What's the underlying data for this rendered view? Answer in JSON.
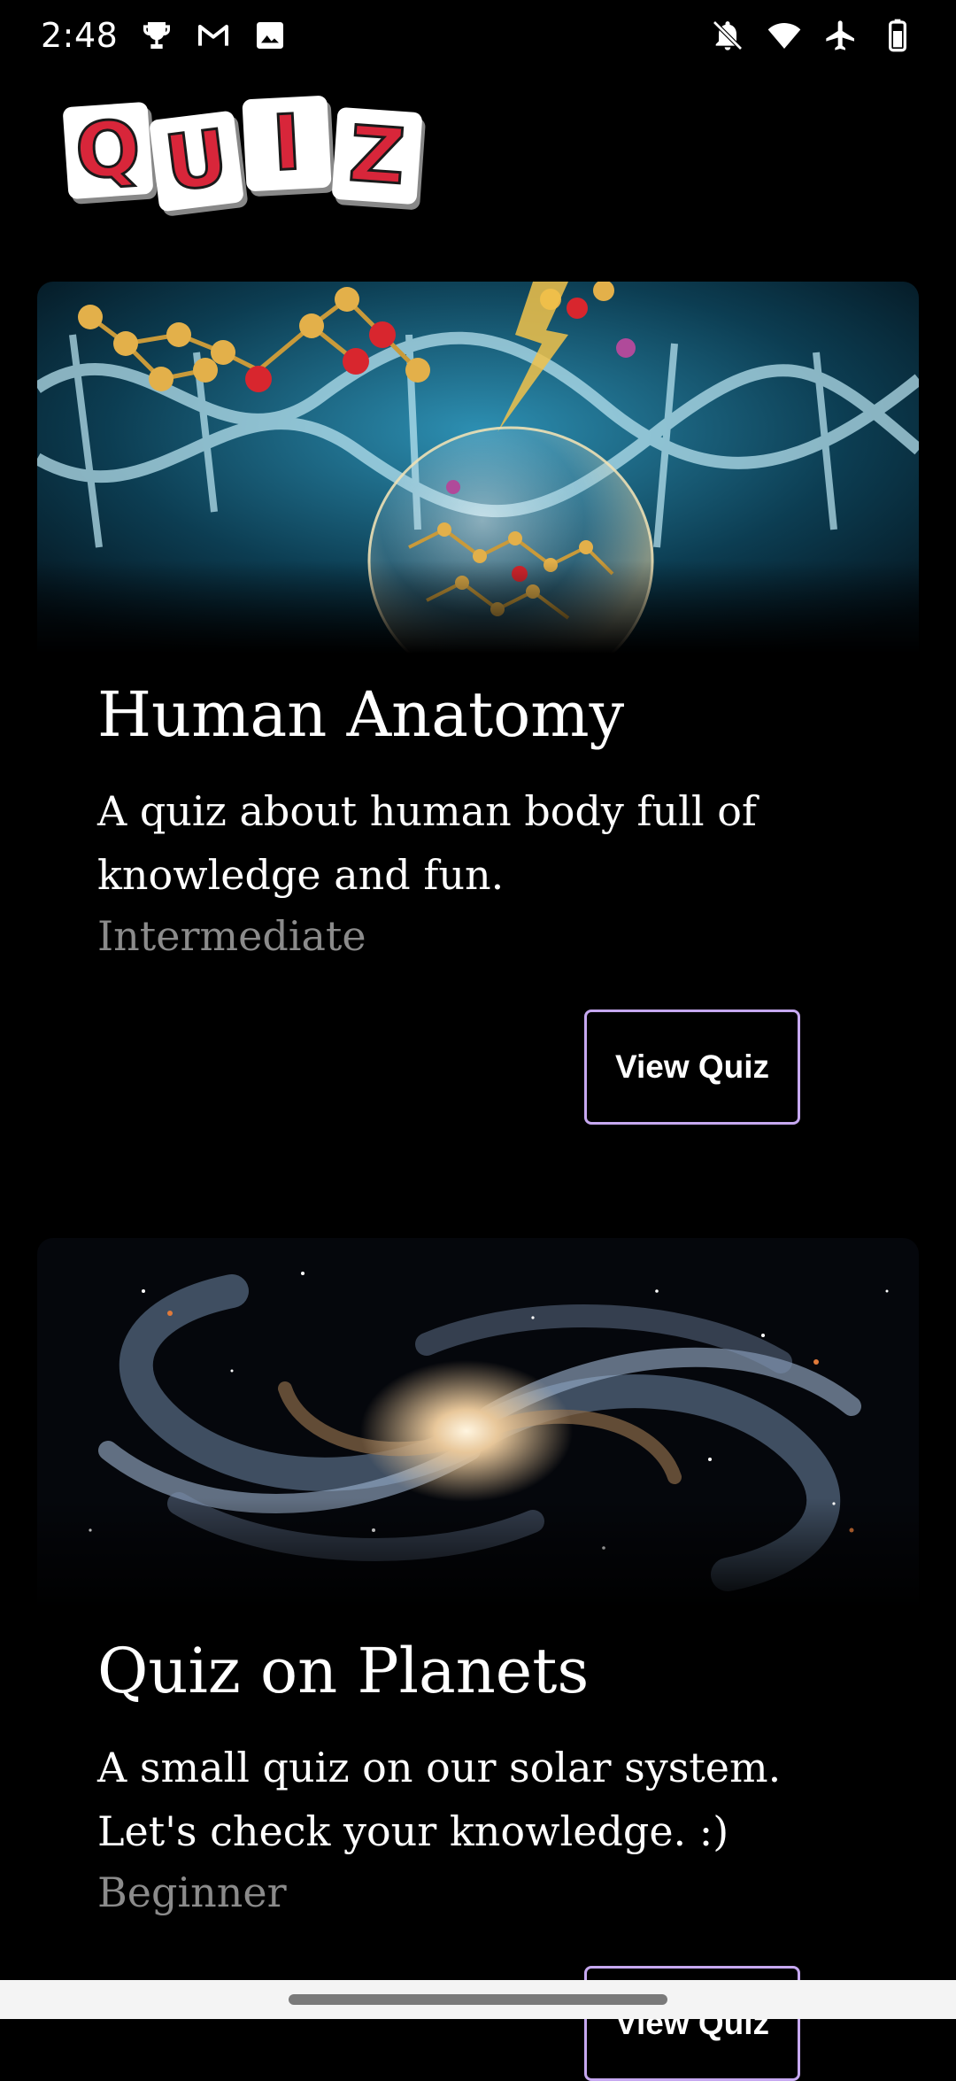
{
  "status_bar": {
    "time": "2:48",
    "left_icons": [
      "trophy-icon",
      "gmail-icon",
      "image-icon"
    ],
    "right_icons": [
      "bell-off-icon",
      "wifi-icon",
      "airplane-icon",
      "battery-icon"
    ]
  },
  "logo": {
    "letters": [
      "Q",
      "U",
      "I",
      "Z"
    ]
  },
  "cards": [
    {
      "title": "Human Anatomy",
      "description": "A quiz about human body full of knowledge and fun.",
      "level": "Intermediate",
      "button_label": "View Quiz",
      "image": "molecules-dna-image"
    },
    {
      "title": "Quiz on Planets",
      "description": "A small quiz on our solar system. Let's check your knowledge. :)",
      "level": "Beginner",
      "button_label": "View Quiz",
      "image": "spiral-galaxy-image"
    }
  ],
  "colors": {
    "background": "#000000",
    "button_border": "#c6a8f0",
    "level_text": "#8b8b8b",
    "logo_red": "#d8263a"
  }
}
